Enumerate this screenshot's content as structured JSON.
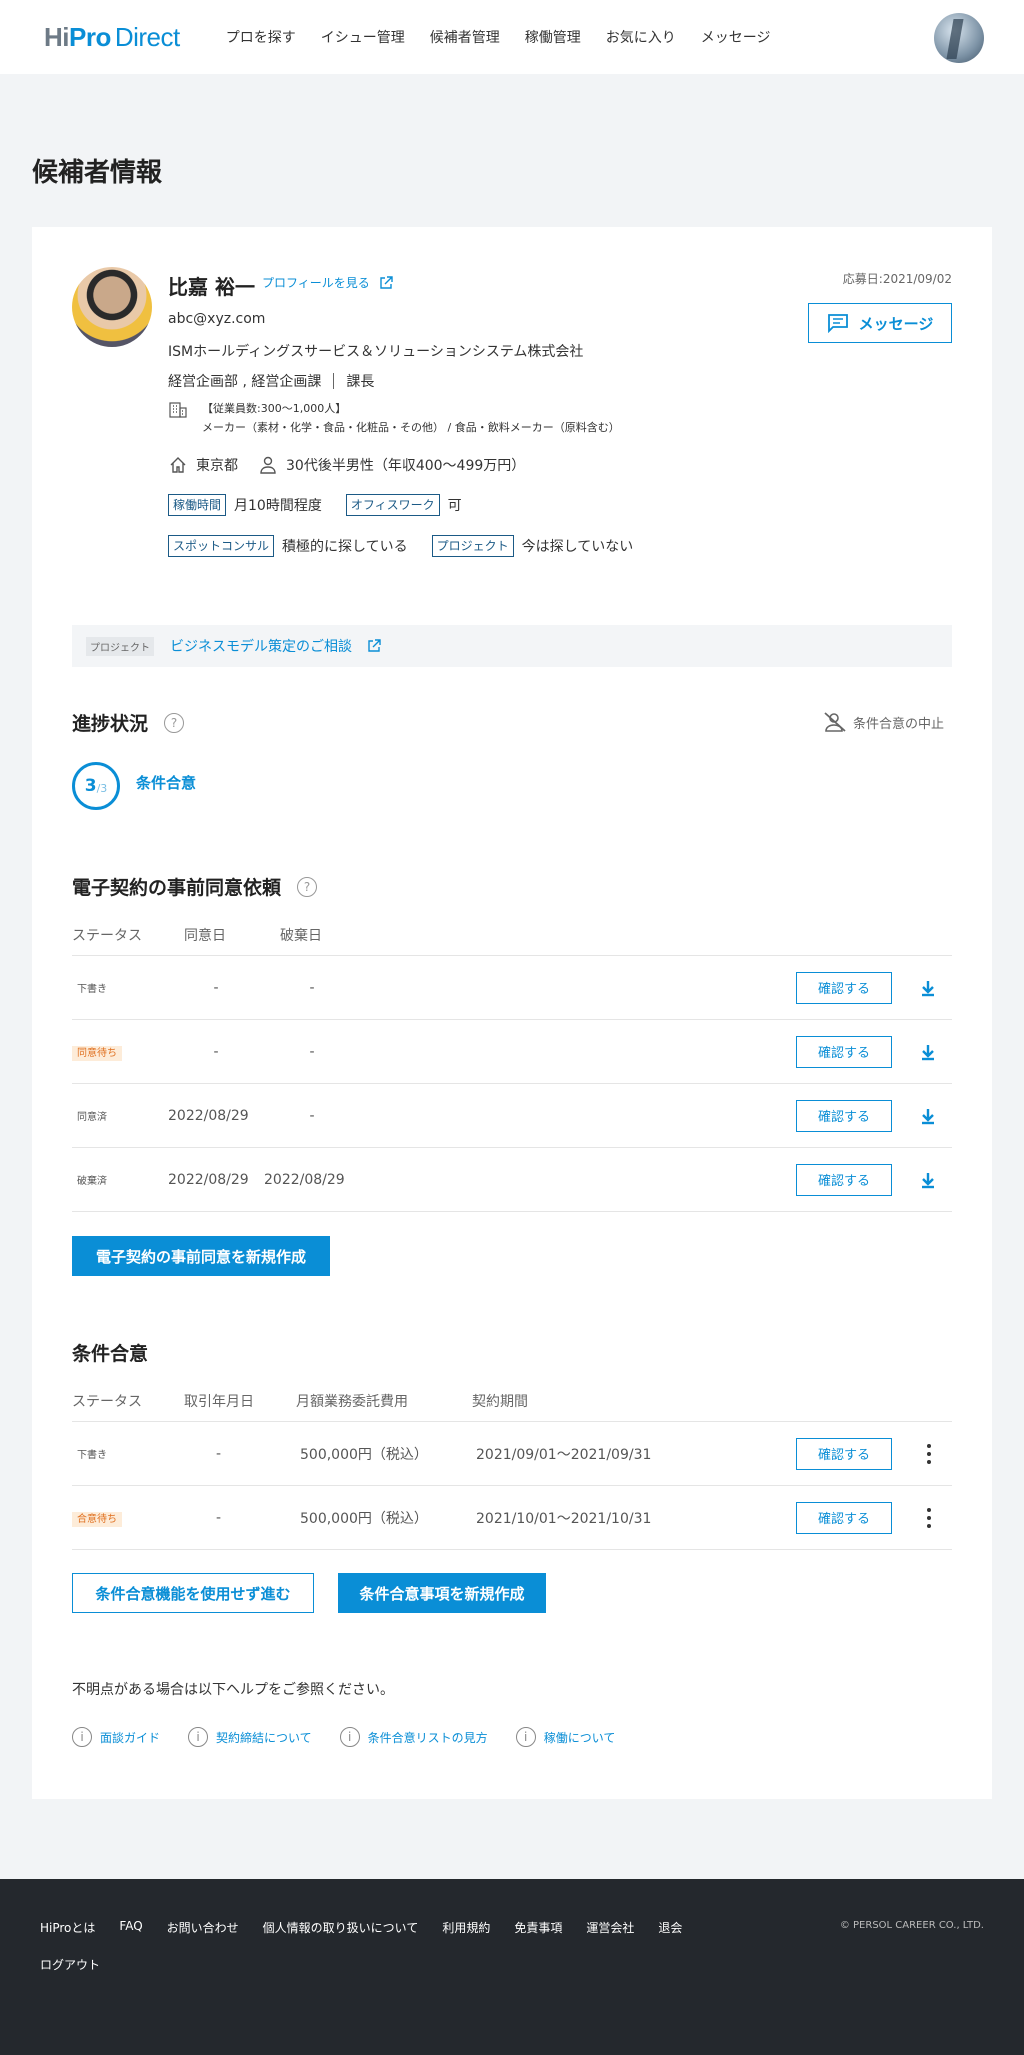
{
  "header": {
    "logo": {
      "hi": "Hi",
      "pro": "Pro",
      "direct": "Direct"
    },
    "nav": [
      "プロを探す",
      "イシュー管理",
      "候補者管理",
      "稼働管理",
      "お気に入り",
      "メッセージ"
    ]
  },
  "page_title": "候補者情報",
  "candidate": {
    "name": "比嘉 裕一",
    "profile_link": "プロフィールを見る",
    "email": "abc@xyz.com",
    "company": "ISMホールディングスサービス＆ソリューションシステム株式会社",
    "department": "経営企画部 , 経営企画課",
    "position": "課長",
    "employees": "【従業員数:300〜1,000人】",
    "industry": "メーカー（素材・化学・食品・化粧品・その他） / 食品・飲料メーカー（原料含む）",
    "location": "東京都",
    "profile": "30代後半男性（年収400〜499万円）",
    "work_time_tag": "稼働時間",
    "work_time": "月10時間程度",
    "office_tag": "オフィスワーク",
    "office": "可",
    "spot_tag": "スポットコンサル",
    "spot": "積極的に探している",
    "project_tag": "プロジェクト",
    "project": "今は探していない",
    "apply_date": "応募日:2021/09/02",
    "message_button": "メッセージ"
  },
  "project_box": {
    "label": "プロジェクト",
    "link": "ビジネスモデル策定のご相談"
  },
  "progress": {
    "title": "進捗状況",
    "help": "?",
    "stop_link": "条件合意の中止",
    "step_current": "3",
    "step_total": "/3",
    "step_label": "条件合意"
  },
  "econtract": {
    "title": "電子契約の事前同意依頼",
    "help": "?",
    "headers": [
      "ステータス",
      "同意日",
      "破棄日"
    ],
    "rows": [
      {
        "status": "下書き",
        "agree": "-",
        "discard": "-",
        "button": "確認する"
      },
      {
        "status": "同意待ち",
        "agree": "-",
        "discard": "-",
        "button": "確認する"
      },
      {
        "status": "同意済",
        "agree": "2022/08/29",
        "discard": "-",
        "button": "確認する"
      },
      {
        "status": "破棄済",
        "agree": "2022/08/29",
        "discard": "2022/08/29",
        "button": "確認する"
      }
    ],
    "create_button": "電子契約の事前同意を新規作成"
  },
  "conditions": {
    "title": "条件合意",
    "headers": [
      "ステータス",
      "取引年月日",
      "月額業務委託費用",
      "契約期間"
    ],
    "rows": [
      {
        "status": "下書き",
        "date": "-",
        "fee": "500,000円（税込）",
        "period": "2021/09/01〜2021/09/31",
        "button": "確認する"
      },
      {
        "status": "合意待ち",
        "date": "-",
        "fee": "500,000円（税込）",
        "period": "2021/10/01〜2021/10/31",
        "button": "確認する"
      }
    ],
    "skip_button": "条件合意機能を使用せず進む",
    "create_button": "条件合意事項を新規作成"
  },
  "help": {
    "text": "不明点がある場合は以下ヘルプをご参照ください。",
    "links": [
      "面談ガイド",
      "契約締結について",
      "条件合意リストの見方",
      "稼働について"
    ]
  },
  "footer": {
    "links": [
      "HiProとは",
      "FAQ",
      "お問い合わせ",
      "個人情報の取り扱いについて",
      "利用規約",
      "免責事項",
      "運営会社",
      "退会",
      "ログアウト"
    ],
    "copyright": "© PERSOL CAREER CO., LTD."
  },
  "colors": {
    "accent": "#0a8ed6",
    "footer_bg": "#24282d",
    "page_bg": "#f2f4f6"
  }
}
